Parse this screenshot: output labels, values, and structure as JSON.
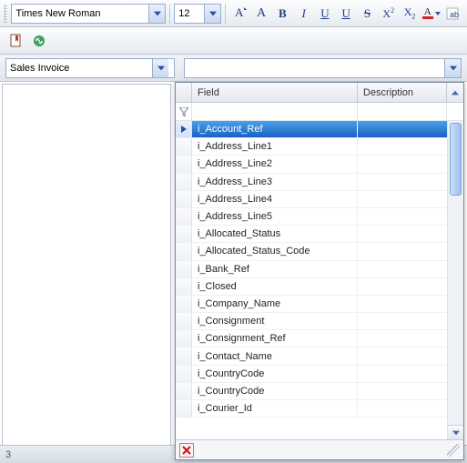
{
  "toolbar": {
    "font_family": "Times New Roman",
    "font_size": "12",
    "buttons": {
      "font_style": "A",
      "grow": "A",
      "bold": "B",
      "italic": "I",
      "underline": "U",
      "underline2": "U",
      "strike": "S",
      "super": "X",
      "super_exp": "2",
      "sub": "X",
      "sub_exp": "2",
      "font_color": "A"
    }
  },
  "selector": {
    "layout": "Sales Invoice",
    "field": ""
  },
  "grid": {
    "header_field": "Field",
    "header_desc": "Description",
    "selected_index": 0,
    "fields": [
      "i_Account_Ref",
      "i_Address_Line1",
      "i_Address_Line2",
      "i_Address_Line3",
      "i_Address_Line4",
      "i_Address_Line5",
      "i_Allocated_Status",
      "i_Allocated_Status_Code",
      "i_Bank_Ref",
      "i_Closed",
      "i_Company_Name",
      "i_Consignment",
      "i_Consignment_Ref",
      "i_Contact_Name",
      "i_CountryCode",
      "i_CountryCode",
      "i_Courier_Id"
    ]
  },
  "status": {
    "text": "3"
  }
}
